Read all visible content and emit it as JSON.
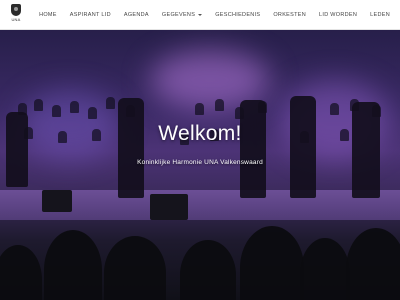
{
  "brand": {
    "logo_text": "UNA",
    "logo_icon": "crest-icon"
  },
  "nav": {
    "items": [
      {
        "label": "HOME"
      },
      {
        "label": "ASPIRANT LID"
      },
      {
        "label": "AGENDA"
      },
      {
        "label": "GEGEVENS",
        "has_dropdown": true
      },
      {
        "label": "GESCHIEDENIS"
      },
      {
        "label": "ORKESTEN"
      },
      {
        "label": "LID WORDEN"
      },
      {
        "label": "LEDEN"
      }
    ]
  },
  "hero": {
    "title": "Welkom!",
    "subtitle": "Koninklijke Harmonie UNA Valkenswaard",
    "image": "orchestra-concert-photo"
  },
  "colors": {
    "nav_bg": "#ffffff",
    "nav_text": "#444444",
    "hero_overlay": "#3b2a66"
  }
}
